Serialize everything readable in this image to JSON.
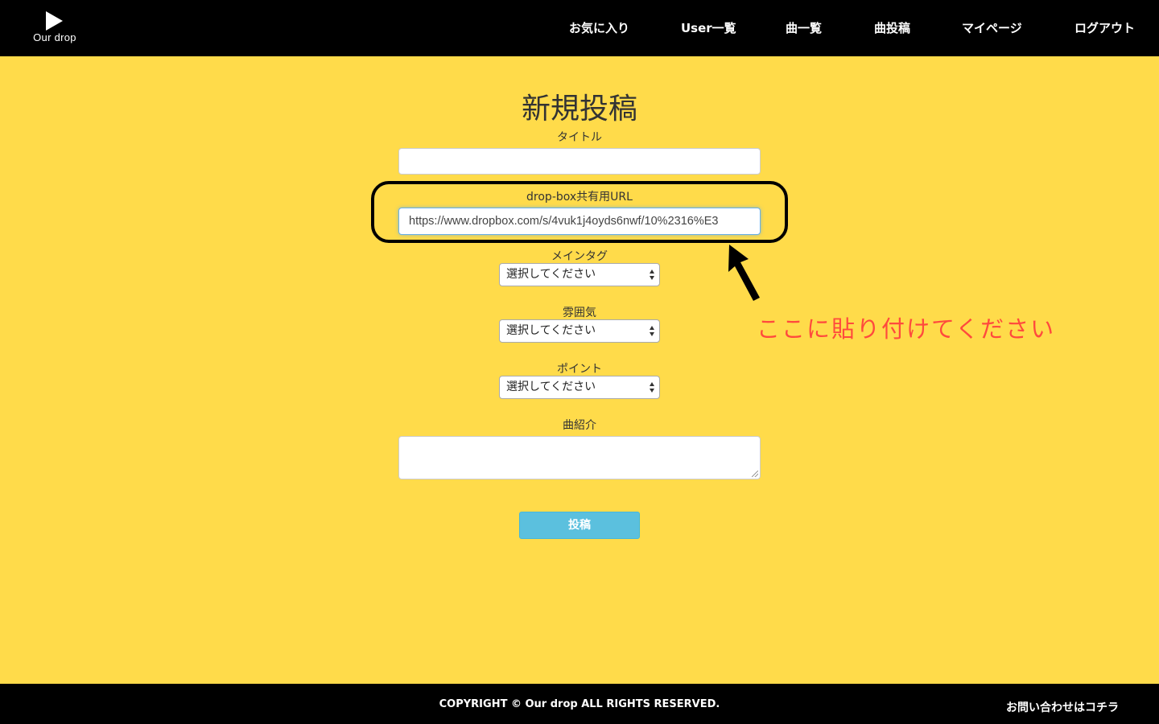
{
  "header": {
    "logo_text": "Our drop",
    "logo_icon": "play-icon",
    "nav": {
      "favorites": "お気に入り",
      "users": "User一覧",
      "songs": "曲一覧",
      "post": "曲投稿",
      "mypage": "マイページ",
      "logout": "ログアウト"
    }
  },
  "form": {
    "page_title": "新規投稿",
    "title_label": "タイトル",
    "title_value": "",
    "url_label": "drop-box共有用URL",
    "url_value": "https://www.dropbox.com/s/4vuk1j4oyds6nwf/10%2316%E3",
    "main_tag_label": "メインタグ",
    "main_tag_selected": "選択してください",
    "mood_label": "雰囲気",
    "mood_selected": "選択してください",
    "point_label": "ポイント",
    "point_selected": "選択してください",
    "intro_label": "曲紹介",
    "intro_value": "",
    "submit_label": "投稿"
  },
  "annotation": {
    "text": "ここに貼り付けてください",
    "text_color": "#ff4a3d"
  },
  "footer": {
    "copyright": "COPYRIGHT © Our drop ALL RIGHTS RESERVED.",
    "contact": "お問い合わせはコチラ"
  },
  "colors": {
    "background": "#ffdb4a",
    "header_bg": "#000000",
    "submit_button": "#5bc0de"
  }
}
